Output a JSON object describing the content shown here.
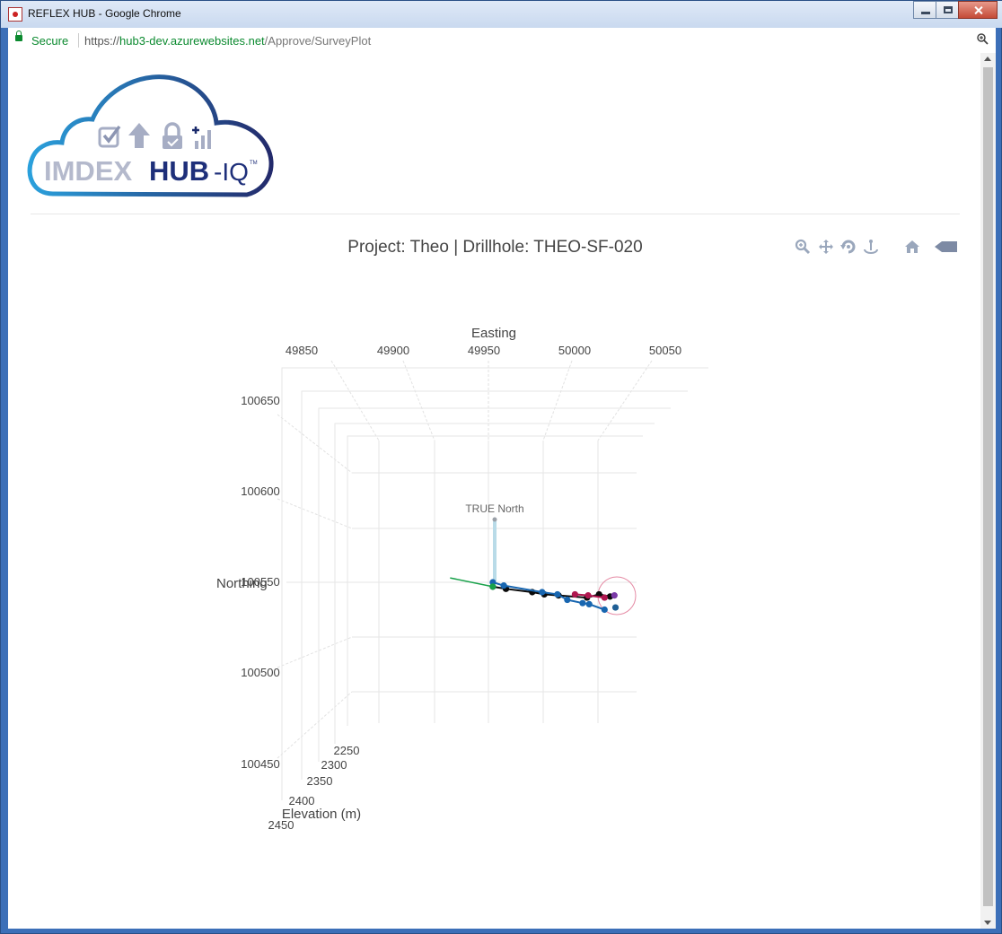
{
  "window": {
    "title": "REFLEX HUB - Google Chrome"
  },
  "address_bar": {
    "secure_label": "Secure",
    "url_scheme": "https://",
    "url_host": "hub3-dev.azurewebsites.net",
    "url_path": "/Approve/SurveyPlot"
  },
  "logo": {
    "text_left": "IMDEX",
    "text_hub": "HUB",
    "text_suffix": "-IQ",
    "trademark": "TM"
  },
  "page": {
    "title": "Project: Theo | Drillhole: THEO-SF-020"
  },
  "modebar": {
    "icons": [
      "zoom-icon",
      "pan-icon",
      "orbit-rotation-icon",
      "turntable-rotation-icon",
      "reset-camera-icon",
      "camera-save-icon"
    ]
  },
  "chart_data": {
    "type": "scatter3d",
    "axes": {
      "x": {
        "title": "Easting",
        "ticks": [
          "49850",
          "49900",
          "49950",
          "50000",
          "50050"
        ]
      },
      "y": {
        "title": "Northing",
        "ticks": [
          "100650",
          "100600",
          "100550",
          "100500",
          "100450"
        ]
      },
      "z": {
        "title": "Elevation (m)",
        "ticks": [
          "2250",
          "2300",
          "2350",
          "2400",
          "2450"
        ]
      }
    },
    "annotations": [
      {
        "text": "TRUE North"
      }
    ],
    "series": [
      {
        "color": "#0a0a0a",
        "points": [
          [
            49954,
            100546
          ],
          [
            49966,
            100544
          ],
          [
            49990,
            100541
          ],
          [
            50001,
            100539
          ],
          [
            50014,
            100538
          ],
          [
            50040,
            100536
          ],
          [
            50051,
            100539
          ],
          [
            50061,
            100537
          ]
        ]
      },
      {
        "color": "#1866b0",
        "points": [
          [
            49954,
            100550
          ],
          [
            49964,
            100547
          ],
          [
            49999,
            100541
          ],
          [
            50013,
            100539
          ],
          [
            50022,
            100534
          ],
          [
            50036,
            100531
          ],
          [
            50042,
            100530
          ],
          [
            50056,
            100525
          ]
        ]
      },
      {
        "color": "#b0174f",
        "points": [
          [
            50029,
            100539
          ],
          [
            50041,
            100538
          ],
          [
            50056,
            100536
          ]
        ]
      },
      {
        "color": "#7b3aa7",
        "points": [
          [
            50065,
            100538
          ]
        ]
      },
      {
        "color": "#1f5f95",
        "points": [
          [
            50066,
            100527
          ]
        ]
      },
      {
        "color": "#18a14a",
        "points": [
          [
            49915,
            100554
          ],
          [
            49954,
            100546
          ]
        ]
      }
    ],
    "colors": {
      "background": "#ffffff",
      "grid": "#e6e6e6",
      "north_arrow": "#b9dbe8",
      "highlight_circle": "#e58aa4"
    }
  }
}
